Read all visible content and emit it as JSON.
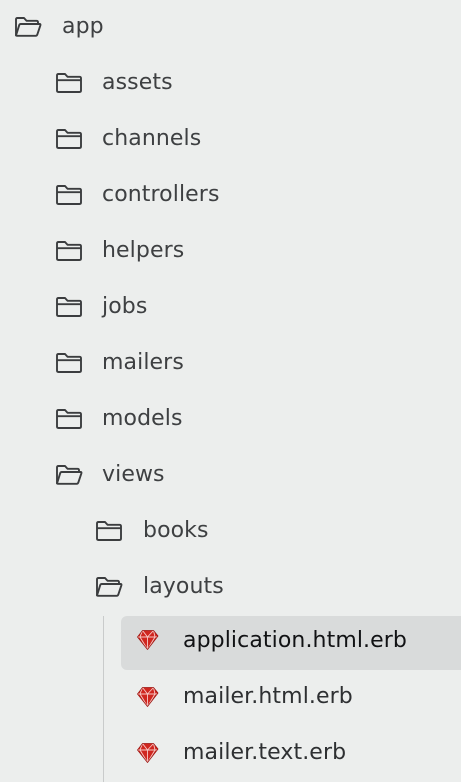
{
  "tree": {
    "root": {
      "label": "app",
      "icon": "folder-open-icon"
    },
    "app_children": [
      {
        "label": "assets",
        "icon": "folder-icon"
      },
      {
        "label": "channels",
        "icon": "folder-icon"
      },
      {
        "label": "controllers",
        "icon": "folder-icon"
      },
      {
        "label": "helpers",
        "icon": "folder-icon"
      },
      {
        "label": "jobs",
        "icon": "folder-icon"
      },
      {
        "label": "mailers",
        "icon": "folder-icon"
      },
      {
        "label": "models",
        "icon": "folder-icon"
      },
      {
        "label": "views",
        "icon": "folder-open-icon"
      }
    ],
    "views_children": [
      {
        "label": "books",
        "icon": "folder-icon"
      },
      {
        "label": "layouts",
        "icon": "folder-open-icon"
      }
    ],
    "layouts_children": [
      {
        "label": "application.html.erb",
        "icon": "ruby-file-icon",
        "selected": true
      },
      {
        "label": "mailer.html.erb",
        "icon": "ruby-file-icon",
        "selected": false
      },
      {
        "label": "mailer.text.erb",
        "icon": "ruby-file-icon",
        "selected": false
      }
    ]
  },
  "colors": {
    "background": "#eceeed",
    "selected_background": "#d9dbdb",
    "folder_stroke": "#3b3d3f",
    "ruby_red": "#d0261f"
  }
}
